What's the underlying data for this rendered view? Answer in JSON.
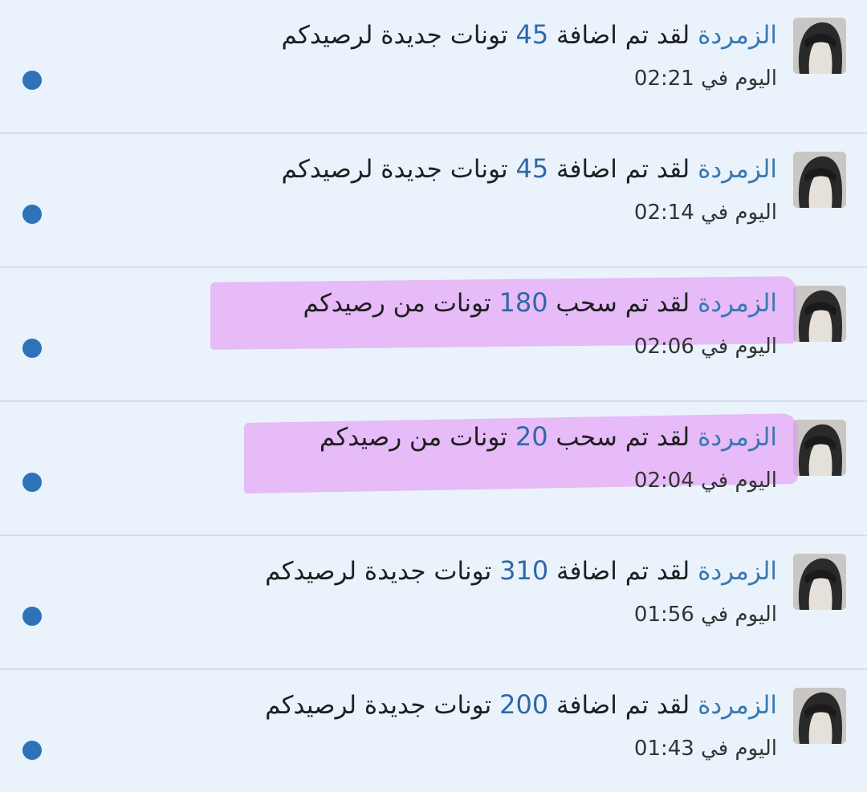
{
  "notifications": [
    {
      "sender": "الزمردة",
      "pre": "لقد تم اضافة",
      "amount": "45",
      "post": "تونات جديدة لرصيدكم",
      "day": "اليوم في",
      "time": "02:21"
    },
    {
      "sender": "الزمردة",
      "pre": "لقد تم اضافة",
      "amount": "45",
      "post": "تونات جديدة لرصيدكم",
      "day": "اليوم في",
      "time": "02:14"
    },
    {
      "sender": "الزمردة",
      "pre": "لقد تم سحب",
      "amount": "180",
      "post": "تونات من رصيدكم",
      "day": "اليوم في",
      "time": "02:06"
    },
    {
      "sender": "الزمردة",
      "pre": "لقد تم سحب",
      "amount": "20",
      "post": "تونات من رصيدكم",
      "day": "اليوم في",
      "time": "02:04"
    },
    {
      "sender": "الزمردة",
      "pre": "لقد تم اضافة",
      "amount": "310",
      "post": "تونات جديدة لرصيدكم",
      "day": "اليوم في",
      "time": "01:56"
    },
    {
      "sender": "الزمردة",
      "pre": "لقد تم اضافة",
      "amount": "200",
      "post": "تونات جديدة لرصيدكم",
      "day": "اليوم في",
      "time": "01:43"
    }
  ],
  "colors": {
    "background": "#eaf3fc",
    "link": "#3a78b0",
    "unread_dot": "#2e72b8",
    "highlight": "#e296f5"
  }
}
